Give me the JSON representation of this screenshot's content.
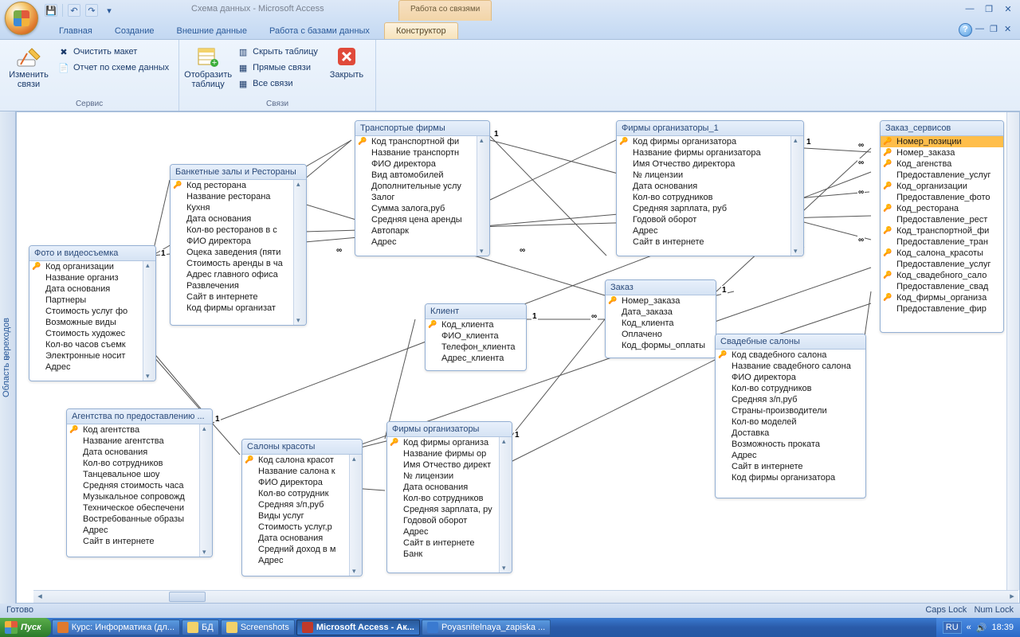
{
  "titlebar": {
    "title": "Схема данных - Microsoft Access",
    "context_tab": "Работа со связями"
  },
  "tabs": {
    "home": "Главная",
    "create": "Создание",
    "external": "Внешние данные",
    "db_tools": "Работа с базами данных",
    "design": "Конструктор"
  },
  "ribbon": {
    "g1": {
      "label": "Сервис",
      "edit_rels": "Изменить связи",
      "clear_layout": "Очистить макет",
      "rel_report": "Отчет по схеме данных"
    },
    "g2": {
      "label": "Связи",
      "show_table": "Отобразить таблицу",
      "hide_table": "Скрыть таблицу",
      "direct_rels": "Прямые связи",
      "all_rels": "Все связи",
      "close": "Закрыть"
    }
  },
  "navpane": {
    "label": "Область переходов"
  },
  "tables": {
    "t1": {
      "title": "Фото и видеосъемка",
      "fields": [
        "Код организации",
        "Название организ",
        "Дата основания",
        "Партнеры",
        "Стоимость услуг фо",
        "Возможные виды",
        "Стоимость художес",
        "Кол-во часов съемк",
        "Электронные носит",
        "Адрес"
      ]
    },
    "t2": {
      "title": "Банкетные залы и Рестораны",
      "fields": [
        "Код ресторана",
        "Название ресторана",
        "Кухня",
        "Дата основания",
        "Кол-во ресторанов в с",
        "ФИО директора",
        "Оцека заведения (пяти",
        "Стоимость аренды в ча",
        "Адрес главного офиса",
        "Развлечения",
        "Сайт в интернете",
        "Код фирмы организат"
      ]
    },
    "t3": {
      "title": "Транспортые фирмы",
      "fields": [
        "Код транспортной фи",
        "Название транспортн",
        "ФИО директора",
        "Вид автомобилей",
        "Дополнительные услу",
        "Залог",
        "Сумма залога,руб",
        "Средняя цена аренды",
        "Автопарк",
        "Адрес"
      ]
    },
    "t4": {
      "title": "Фирмы организаторы_1",
      "fields": [
        "Код фирмы организатора",
        "Название фирмы организатора",
        "Имя Отчество директора",
        "№ лицензии",
        "Дата основания",
        "Кол-во сотрудников",
        "Средняя зарплата, руб",
        "Годовой оборот",
        "Адрес",
        "Сайт в интернете"
      ]
    },
    "t5": {
      "title": "Заказ_сервисов",
      "fields": [
        "Номер_позиции",
        "Номер_заказа",
        "Код_агенства",
        "Предоставление_услуг",
        "Код_организации",
        "Предоставление_фото",
        "Код_ресторана",
        "Предоставление_рест",
        "Код_транспортной_фи",
        "Предоставление_тран",
        "Код_салона_красоты",
        "Предоставление_услуг",
        "Код_свадебного_сало",
        "Предоставление_свад",
        "Код_фирмы_организа",
        "Предоставление_фир"
      ]
    },
    "t6": {
      "title": "Клиент",
      "fields": [
        "Код_клиента",
        "ФИО_клиента",
        "Телефон_клиента",
        "Адрес_клиента"
      ]
    },
    "t7": {
      "title": "Заказ",
      "fields": [
        "Номер_заказа",
        "Дата_заказа",
        "Код_клиента",
        "Оплачено",
        "Код_формы_оплаты"
      ]
    },
    "t8": {
      "title": "Свадебные салоны",
      "fields": [
        "Код свадебного салона",
        "Название свадебного салона",
        "ФИО директора",
        "Кол-во сотрудников",
        "Средняя з/п,руб",
        "Страны-производители",
        "Кол-во моделей",
        "Доставка",
        "Возможность проката",
        "Адрес",
        "Сайт в интернете",
        "Код фирмы организатора"
      ]
    },
    "t9": {
      "title": "Агентства по предоставлению ...",
      "fields": [
        "Код агентства",
        "Название агентства",
        "Дата основания",
        "Кол-во сотрудников",
        "Танцевальное шоу",
        "Средняя стоимость часа",
        "Музыкальное сопровожд",
        "Техническое обеспечени",
        "Востребованные образы",
        "Адрес",
        "Сайт в интернете"
      ]
    },
    "t10": {
      "title": "Салоны красоты",
      "fields": [
        "Код салона красот",
        "Название салона к",
        "ФИО директора",
        "Кол-во сотрудник",
        "Средняя з/п,руб",
        "Виды услуг",
        "Стоимость услуг,р",
        "Дата основания",
        "Средний доход в м",
        "Адрес"
      ]
    },
    "t11": {
      "title": "Фирмы организаторы",
      "fields": [
        "Код фирмы организа",
        "Название фирмы ор",
        "Имя Отчество директ",
        "№ лицензии",
        "Дата основания",
        "Кол-во сотрудников",
        "Средняя зарплата, ру",
        "Годовой оборот",
        "Адрес",
        "Сайт в интернете",
        "Банк"
      ]
    }
  },
  "status": {
    "ready": "Готово",
    "caps": "Caps Lock",
    "num": "Num Lock"
  },
  "taskbar": {
    "start": "Пуск",
    "items": [
      "Курс: Информатика (дл...",
      "БД",
      "Screenshots",
      "Microsoft Access - Ак...",
      "Poyasnitelnaya_zapiska ..."
    ],
    "lang": "RU",
    "time": "18:39"
  }
}
